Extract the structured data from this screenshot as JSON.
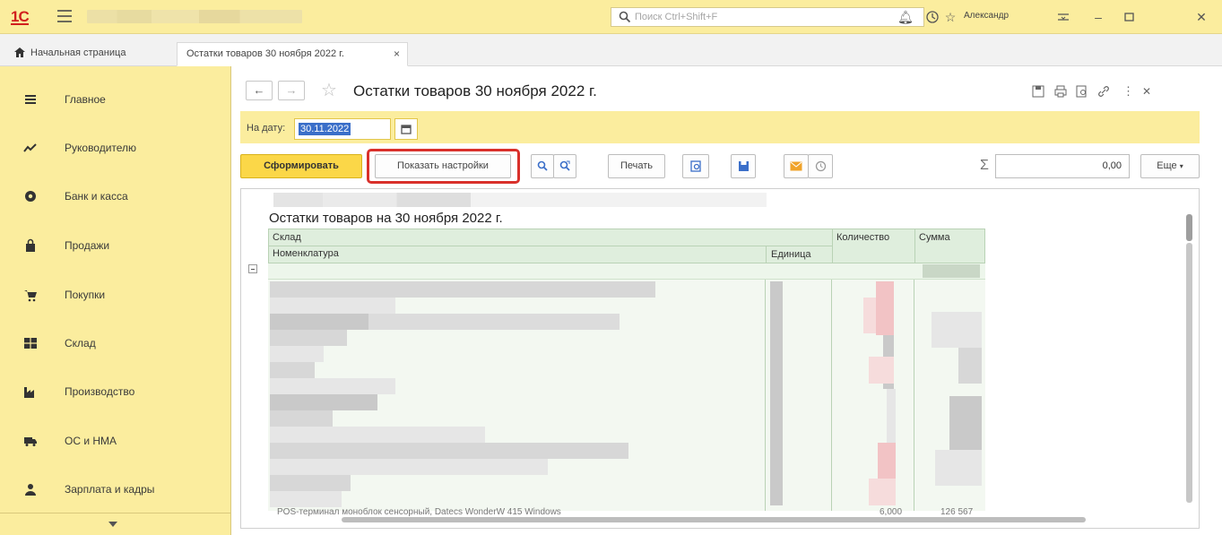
{
  "titlebar": {
    "logo": "1С",
    "search_placeholder": "Поиск Ctrl+Shift+F",
    "user_name": "Александр"
  },
  "tabs": [
    {
      "label": "Начальная страница"
    },
    {
      "label": "Остатки товаров 30 ноября 2022 г.",
      "close": "×"
    }
  ],
  "sidebar": {
    "items": [
      {
        "label": "Главное",
        "icon": "menu-lines-icon"
      },
      {
        "label": "Руководителю",
        "icon": "trend-icon"
      },
      {
        "label": "Банк и касса",
        "icon": "coin-icon"
      },
      {
        "label": "Продажи",
        "icon": "bag-icon"
      },
      {
        "label": "Покупки",
        "icon": "cart-icon"
      },
      {
        "label": "Склад",
        "icon": "warehouse-icon"
      },
      {
        "label": "Производство",
        "icon": "factory-icon"
      },
      {
        "label": "ОС и НМА",
        "icon": "truck-icon"
      },
      {
        "label": "Зарплата и кадры",
        "icon": "person-icon"
      }
    ]
  },
  "form": {
    "title": "Остатки товаров 30 ноября 2022 г.",
    "date_label": "На дату:",
    "date_value": "30.11.2022"
  },
  "commands": {
    "generate": "Сформировать",
    "show_settings": "Показать настройки",
    "print": "Печать",
    "sum_value": "0,00",
    "more": "Еще"
  },
  "report": {
    "title": "Остатки товаров на 30 ноября 2022 г.",
    "col_warehouse": "Склад",
    "col_item": "Номенклатура",
    "col_unit": "Единица",
    "col_qty": "Количество",
    "col_sum": "Сумма",
    "last_row_text": "POS-терминал моноблок сенсорный, Datecs WonderW 415 Windows",
    "last_row_qty": "6,000",
    "last_row_sum": "126 567"
  },
  "colors": {
    "accent_yellow": "#fbed9e",
    "primary_button": "#fbd748",
    "highlight_red": "#d9302b"
  }
}
